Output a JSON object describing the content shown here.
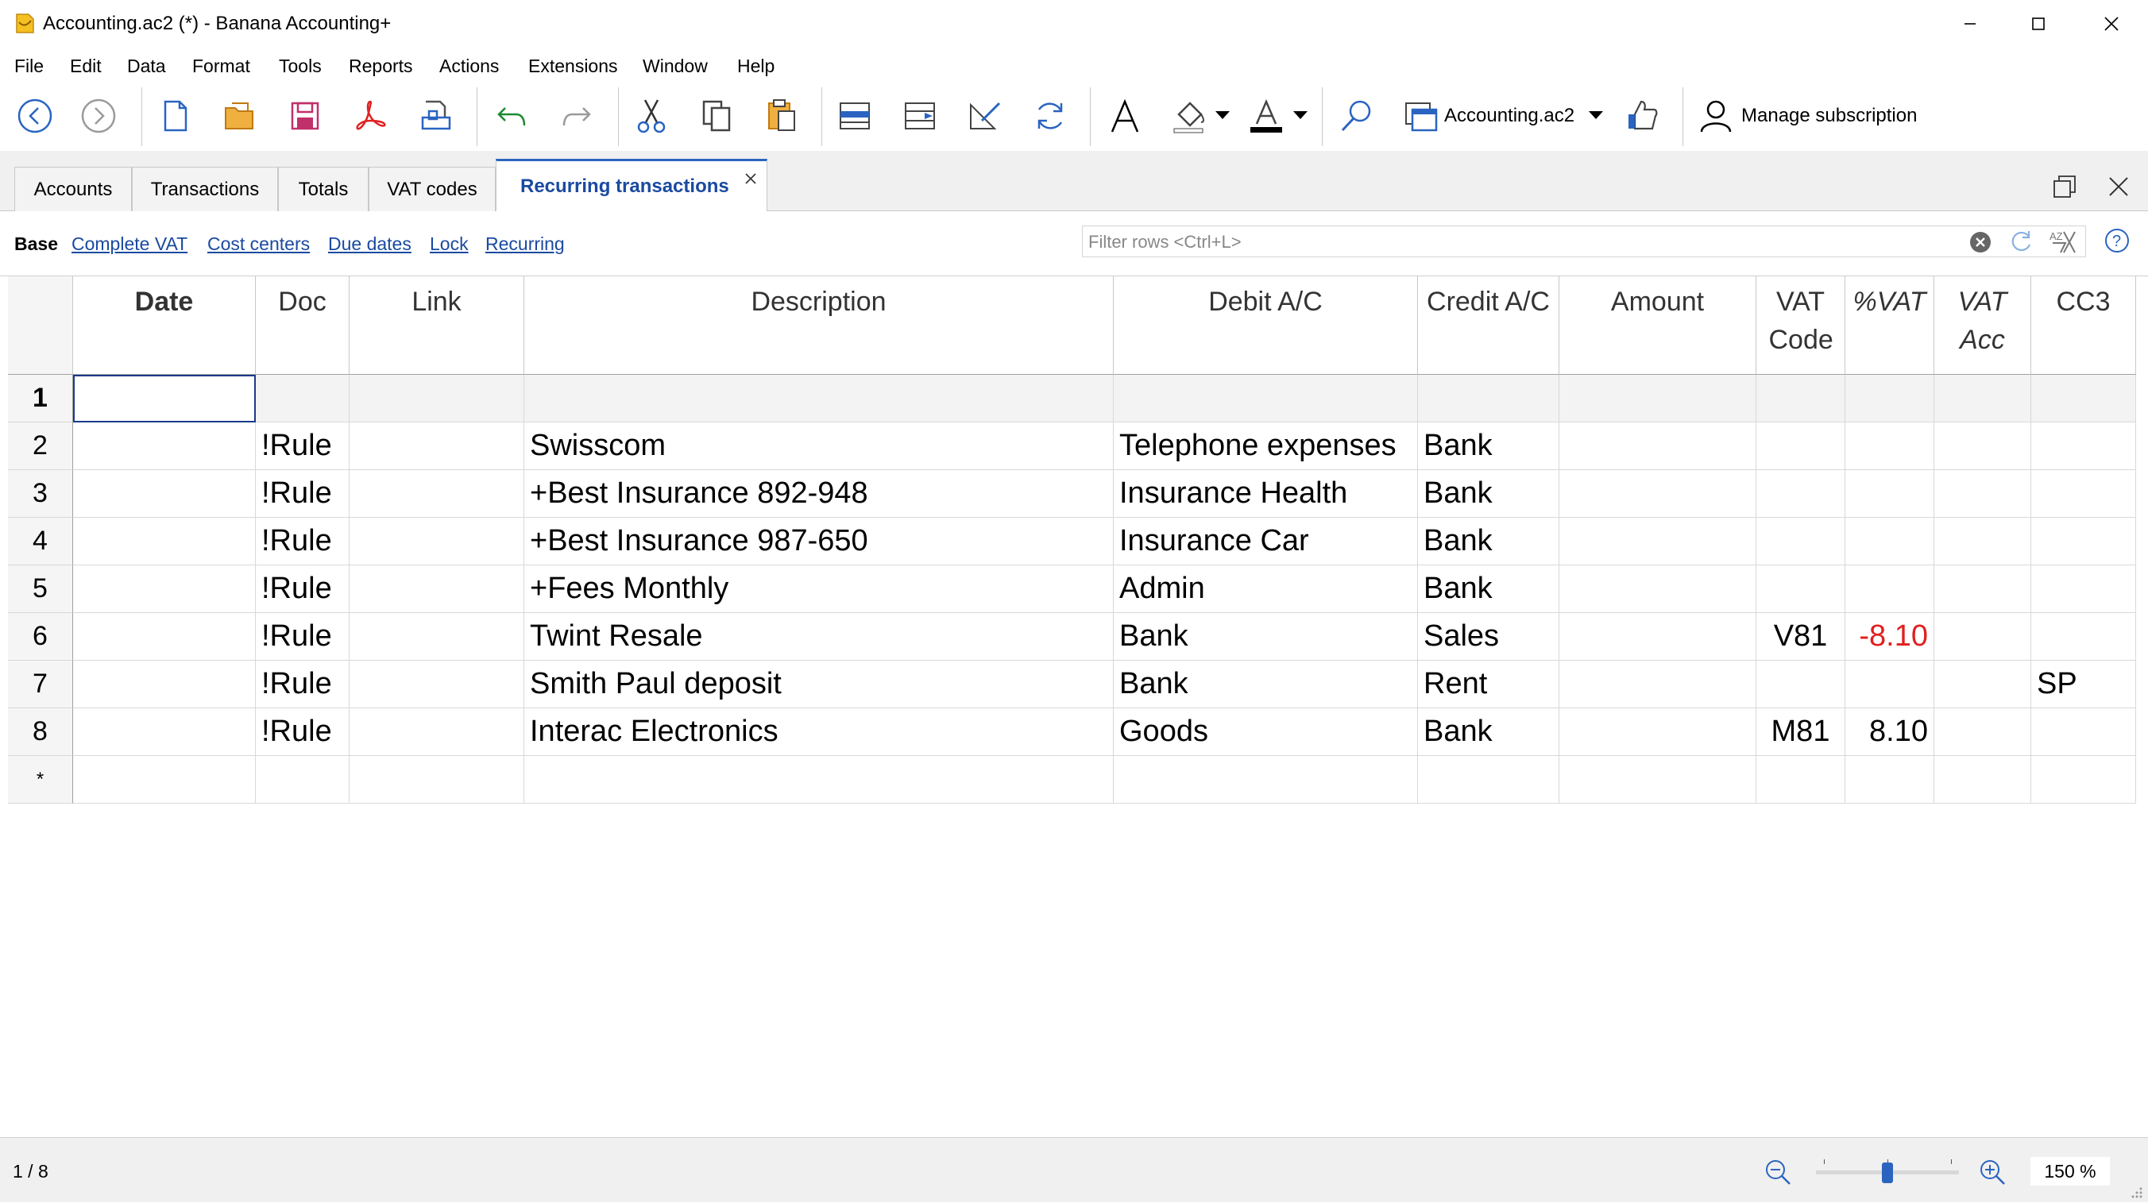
{
  "window": {
    "title": "Accounting.ac2 (*) - Banana Accounting+"
  },
  "menu": [
    "File",
    "Edit",
    "Data",
    "Format",
    "Tools",
    "Reports",
    "Actions",
    "Extensions",
    "Window",
    "Help"
  ],
  "toolbar": {
    "file_name": "Accounting.ac2",
    "manage_subscription": "Manage subscription"
  },
  "tabs": [
    "Accounts",
    "Transactions",
    "Totals",
    "VAT codes",
    "Recurring transactions"
  ],
  "active_tab": "Recurring transactions",
  "views": [
    "Base",
    "Complete VAT",
    "Cost centers",
    "Due dates",
    "Lock",
    "Recurring"
  ],
  "filter": {
    "placeholder": "Filter rows <Ctrl+L>"
  },
  "columns": [
    "Date",
    "Doc",
    "Link",
    "Description",
    "Debit A/C",
    "Credit A/C",
    "Amount",
    "VAT Code",
    "%VAT",
    "VAT Acc",
    "CC3"
  ],
  "rows": [
    {
      "num": "1",
      "doc": "",
      "description": "",
      "debit": "",
      "credit": "",
      "vat_code": "",
      "pct_vat": "",
      "cc3": ""
    },
    {
      "num": "2",
      "doc": "!Rule",
      "description": "Swisscom",
      "debit": "Telephone expenses",
      "credit": "Bank",
      "vat_code": "",
      "pct_vat": "",
      "cc3": ""
    },
    {
      "num": "3",
      "doc": "!Rule",
      "description": "+Best Insurance 892-948",
      "debit": "Insurance Health",
      "credit": "Bank",
      "vat_code": "",
      "pct_vat": "",
      "cc3": ""
    },
    {
      "num": "4",
      "doc": "!Rule",
      "description": "+Best Insurance 987-650",
      "debit": "Insurance Car",
      "credit": "Bank",
      "vat_code": "",
      "pct_vat": "",
      "cc3": ""
    },
    {
      "num": "5",
      "doc": "!Rule",
      "description": "+Fees Monthly",
      "debit": "Admin",
      "credit": "Bank",
      "vat_code": "",
      "pct_vat": "",
      "cc3": ""
    },
    {
      "num": "6",
      "doc": "!Rule",
      "description": "Twint Resale",
      "debit": "Bank",
      "credit": "Sales",
      "vat_code": "V81",
      "pct_vat": "-8.10",
      "cc3": ""
    },
    {
      "num": "7",
      "doc": "!Rule",
      "description": "Smith Paul deposit",
      "debit": "Bank",
      "credit": "Rent",
      "vat_code": "",
      "pct_vat": "",
      "cc3": "SP"
    },
    {
      "num": "8",
      "doc": "!Rule",
      "description": "Interac Electronics",
      "debit": "Goods",
      "credit": "Bank",
      "vat_code": "M81",
      "pct_vat": "8.10",
      "cc3": ""
    },
    {
      "num": "*",
      "doc": "",
      "description": "",
      "debit": "",
      "credit": "",
      "vat_code": "",
      "pct_vat": "",
      "cc3": ""
    }
  ],
  "status": {
    "row_counter": "1 / 8",
    "zoom": "150 %",
    "zoom_level_fraction": 0.5
  },
  "colors": {
    "accent": "#2a64c0",
    "negative": "#e02020",
    "link": "#1a4aa0"
  }
}
